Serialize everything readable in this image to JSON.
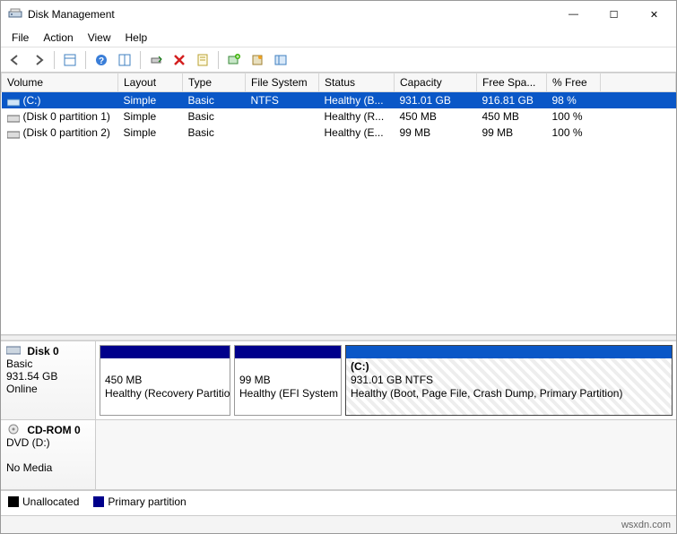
{
  "window": {
    "title": "Disk Management"
  },
  "winbuttons": {
    "min": "—",
    "max": "☐",
    "close": "✕"
  },
  "menu": {
    "file": "File",
    "action": "Action",
    "view": "View",
    "help": "Help"
  },
  "columns": {
    "vol": "Volume",
    "layout": "Layout",
    "type": "Type",
    "fs": "File System",
    "status": "Status",
    "cap": "Capacity",
    "free": "Free Spa...",
    "pct": "% Free"
  },
  "rows": {
    "r0": {
      "vol": "(C:)",
      "layout": "Simple",
      "type": "Basic",
      "fs": "NTFS",
      "status": "Healthy (B...",
      "cap": "931.01 GB",
      "free": "916.81 GB",
      "pct": "98 %"
    },
    "r1": {
      "vol": "(Disk 0 partition 1)",
      "layout": "Simple",
      "type": "Basic",
      "fs": "",
      "status": "Healthy (R...",
      "cap": "450 MB",
      "free": "450 MB",
      "pct": "100 %"
    },
    "r2": {
      "vol": "(Disk 0 partition 2)",
      "layout": "Simple",
      "type": "Basic",
      "fs": "",
      "status": "Healthy (E...",
      "cap": "99 MB",
      "free": "99 MB",
      "pct": "100 %"
    }
  },
  "disk0": {
    "name": "Disk 0",
    "type": "Basic",
    "size": "931.54 GB",
    "state": "Online",
    "p0": {
      "l1": "450 MB",
      "l2": "Healthy (Recovery Partition)"
    },
    "p1": {
      "l1": "99 MB",
      "l2": "Healthy (EFI System"
    },
    "p2": {
      "l0": "(C:)",
      "l1": "931.01 GB NTFS",
      "l2": "Healthy (Boot, Page File, Crash Dump, Primary Partition)"
    }
  },
  "cdrom": {
    "name": "CD-ROM 0",
    "type": "DVD (D:)",
    "state": "No Media"
  },
  "legend": {
    "unalloc": "Unallocated",
    "primary": "Primary partition"
  },
  "status": {
    "watermark": "wsxdn.com"
  },
  "colors": {
    "stripe": "#00008b",
    "unalloc": "#000000"
  }
}
